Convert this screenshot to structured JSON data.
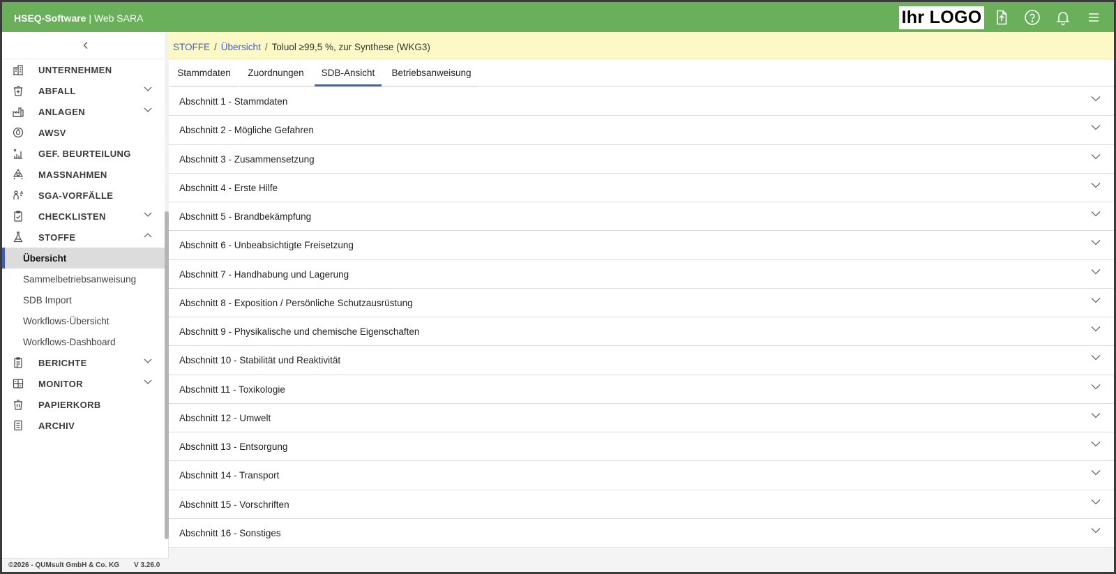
{
  "header": {
    "brand_bold": "HSEQ-Software",
    "brand_rest": " | Web SARA",
    "logo_text": "Ihr LOGO",
    "icons": [
      "upload-file-icon",
      "help-icon",
      "bell-icon",
      "menu-icon"
    ]
  },
  "sidebar": {
    "items": [
      {
        "label": "UNTERNEHMEN",
        "icon": "building-icon",
        "expandable": false
      },
      {
        "label": "ABFALL",
        "icon": "waste-bin-icon",
        "expandable": true
      },
      {
        "label": "ANLAGEN",
        "icon": "factory-icon",
        "expandable": true
      },
      {
        "label": "AWSV",
        "icon": "water-drop-icon",
        "expandable": false
      },
      {
        "label": "GEF. BEURTEILUNG",
        "icon": "risk-chart-icon",
        "expandable": false
      },
      {
        "label": "MASSNAHMEN",
        "icon": "measures-icon",
        "expandable": false
      },
      {
        "label": "SGA-VORFÄLLE",
        "icon": "incident-icon",
        "expandable": false
      },
      {
        "label": "CHECKLISTEN",
        "icon": "clipboard-check-icon",
        "expandable": true
      },
      {
        "label": "STOFFE",
        "icon": "flask-icon",
        "expandable": true,
        "expanded": true
      }
    ],
    "subitems": [
      {
        "label": "Übersicht",
        "active": true
      },
      {
        "label": "Sammelbetriebsanweisung"
      },
      {
        "label": "SDB Import"
      },
      {
        "label": "Workflows-Übersicht"
      },
      {
        "label": "Workflows-Dashboard"
      }
    ],
    "items_after": [
      {
        "label": "BERICHTE",
        "icon": "report-icon",
        "expandable": true
      },
      {
        "label": "MONITOR",
        "icon": "monitor-icon",
        "expandable": true
      },
      {
        "label": "PAPIERKORB",
        "icon": "trash-icon",
        "expandable": false
      },
      {
        "label": "ARCHIV",
        "icon": "archive-icon",
        "expandable": false
      }
    ]
  },
  "footer": {
    "copyright": "©2026 - QUMsult GmbH & Co. KG",
    "version": "V 3.26.0"
  },
  "breadcrumb": {
    "level1": "STOFFE",
    "level2": "Übersicht",
    "current": "Toluol ≥99,5 %, zur Synthese (WKG3)"
  },
  "tabs": [
    {
      "label": "Stammdaten"
    },
    {
      "label": "Zuordnungen"
    },
    {
      "label": "SDB-Ansicht",
      "active": true
    },
    {
      "label": "Betriebsanweisung"
    }
  ],
  "sections": [
    "Abschnitt 1 - Stammdaten",
    "Abschnitt 2 - Mögliche Gefahren",
    "Abschnitt 3 - Zusammensetzung",
    "Abschnitt 4 - Erste Hilfe",
    "Abschnitt 5 - Brandbekämpfung",
    "Abschnitt 6 - Unbeabsichtigte Freisetzung",
    "Abschnitt 7 - Handhabung und Lagerung",
    "Abschnitt 8 - Exposition / Persönliche Schutzausrüstung",
    "Abschnitt 9 - Physikalische und chemische Eigenschaften",
    "Abschnitt 10 - Stabilität und Reaktivität",
    "Abschnitt 11 - Toxikologie",
    "Abschnitt 12 - Umwelt",
    "Abschnitt 13 - Entsorgung",
    "Abschnitt 14 - Transport",
    "Abschnitt 15 - Vorschriften",
    "Abschnitt 16 - Sonstiges"
  ],
  "colors": {
    "header_bg": "#6ab05a",
    "breadcrumb_bg": "#fdf9c6",
    "accent": "#3b5bd6"
  }
}
